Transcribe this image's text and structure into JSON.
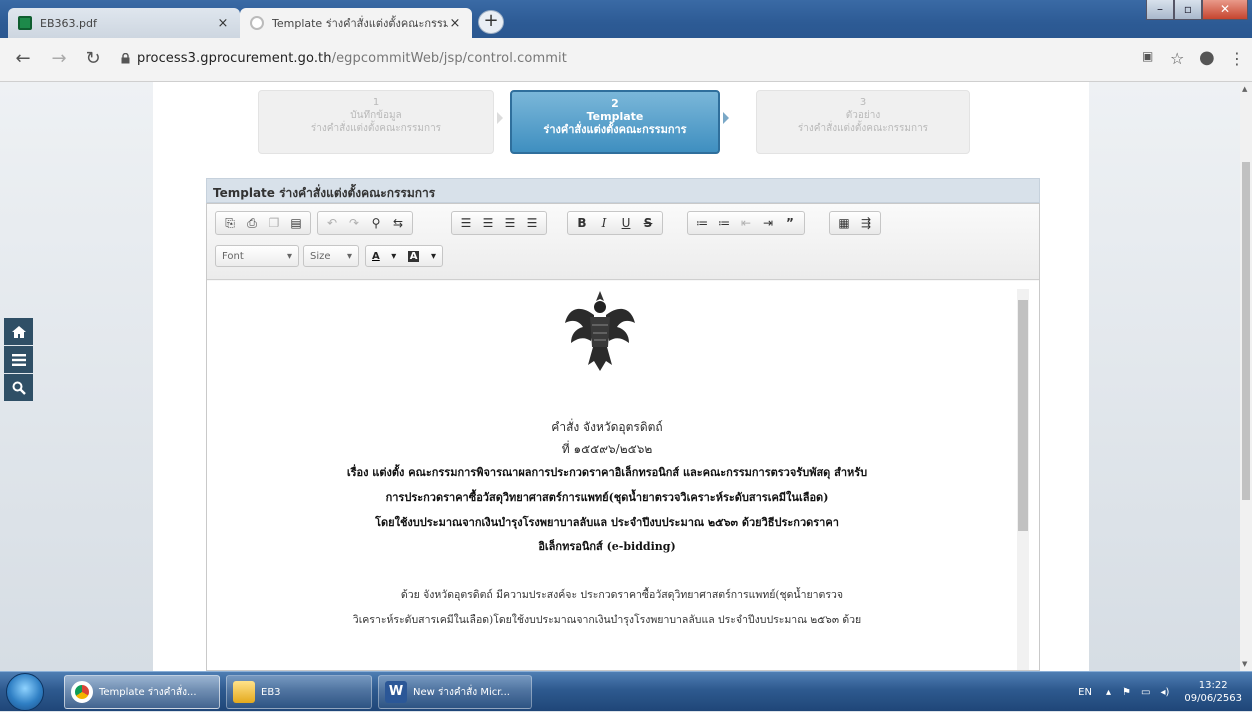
{
  "browser": {
    "tabs": [
      {
        "title": "EB363.pdf",
        "close": "×"
      },
      {
        "title": "Template ร่างคำสั่งแต่งตั้งคณะกรรมก",
        "close": "×"
      }
    ],
    "new_tab": "+",
    "url_host": "process3.gprocurement.go.th",
    "url_path": "/egpcommitWeb/jsp/control.commit"
  },
  "steps": [
    {
      "num": "1",
      "line1": "บันทึกข้อมูล",
      "line2": "ร่างคำสั่งแต่งตั้งคณะกรรมการ"
    },
    {
      "num": "2",
      "line1": "Template",
      "line2": "ร่างคำสั่งแต่งตั้งคณะกรรมการ"
    },
    {
      "num": "3",
      "line1": "ตัวอย่าง",
      "line2": "ร่างคำสั่งแต่งตั้งคณะกรรมการ"
    }
  ],
  "panel": {
    "title": "Template ร่างคำสั่งแต่งตั้งคณะกรรมการ"
  },
  "editor": {
    "font_label": "Font",
    "size_label": "Size",
    "text_color_label": "A",
    "bg_color_label": "A"
  },
  "document": {
    "order_line": "คำสั่ง จังหวัดอุตรดิตถ์",
    "number_line": "ที่ ๑๕๕๙๖/๒๕๖๒",
    "subject": [
      "เรื่อง แต่งตั้ง คณะกรรมการพิจารณาผลการประกวดราคาอิเล็กทรอนิกส์ และคณะกรรมการตรวจรับพัสดุ สำหรับ",
      "การประกวดราคาซื้อวัสดุวิทยาศาสตร์การแพทย์(ชุดน้ำยาตรวจวิเคราะห์ระดับสารเคมีในเลือด)",
      "โดยใช้งบประมาณจากเงินบำรุงโรงพยาบาลลับแล ประจำปีงบประมาณ ๒๕๖๓ ด้วยวิธีประกวดราคา",
      "อิเล็กทรอนิกส์ (e-bidding)"
    ],
    "body": [
      "ด้วย จังหวัดอุตรดิตถ์ มีความประสงค์จะ ประกวดราคาซื้อวัสดุวิทยาศาสตร์การแพทย์(ชุดน้ำยาตรวจ",
      "วิเคราะห์ระดับสารเคมีในเลือด)โดยใช้งบประมาณจากเงินบำรุงโรงพยาบาลลับแล ประจำปีงบประมาณ ๒๕๖๓ ด้วย"
    ]
  },
  "taskbar": {
    "items": [
      {
        "label": "Template ร่างคำสั่ง..."
      },
      {
        "label": "EB3"
      },
      {
        "label": "New ร่างคำสั่ง Micr..."
      }
    ],
    "lang": "EN",
    "time": "13:22",
    "date": "09/06/2563"
  }
}
